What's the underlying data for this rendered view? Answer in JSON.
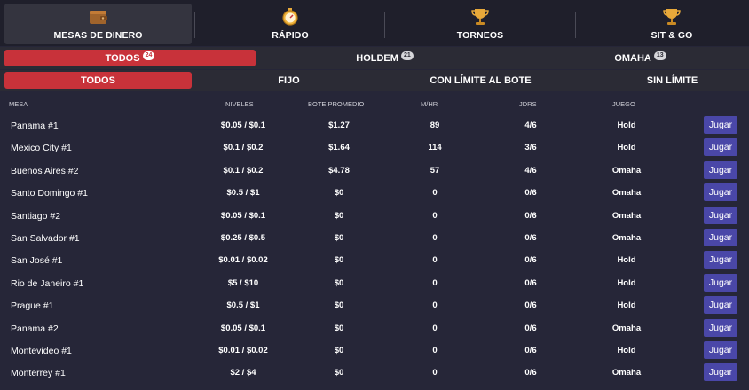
{
  "nav": {
    "tabs": [
      {
        "label": "MESAS DE DINERO",
        "icon": "wallet-icon"
      },
      {
        "label": "RÁPIDO",
        "icon": "stopwatch-icon"
      },
      {
        "label": "TORNEOS",
        "icon": "trophy-icon"
      },
      {
        "label": "SIT & GO",
        "icon": "trophy-icon"
      }
    ]
  },
  "game_filters": [
    {
      "label": "TODOS",
      "count": "24"
    },
    {
      "label": "HOLDEM",
      "count": "21"
    },
    {
      "label": "OMAHA",
      "count": "13"
    }
  ],
  "limit_filters": [
    "TODOS",
    "FIJO",
    "CON LÍMITE AL BOTE",
    "SIN LÍMITE"
  ],
  "table": {
    "headers": {
      "mesa": "MESA",
      "niveles": "NIVELES",
      "bote": "BOTE PROMEDIO",
      "mhr": "M/HR",
      "jdrs": "JDRS",
      "juego": "JUEGO"
    },
    "play_label": "Jugar",
    "rows": [
      [
        "Panama #1",
        "$0.05 / $0.1",
        "$1.27",
        "89",
        "4/6",
        "Hold"
      ],
      [
        "Mexico City #1",
        "$0.1 / $0.2",
        "$1.64",
        "114",
        "3/6",
        "Hold"
      ],
      [
        "Buenos Aires #2",
        "$0.1 / $0.2",
        "$4.78",
        "57",
        "4/6",
        "Omaha"
      ],
      [
        "Santo Domingo #1",
        "$0.5 / $1",
        "$0",
        "0",
        "0/6",
        "Omaha"
      ],
      [
        "Santiago #2",
        "$0.05 / $0.1",
        "$0",
        "0",
        "0/6",
        "Omaha"
      ],
      [
        "San Salvador #1",
        "$0.25 / $0.5",
        "$0",
        "0",
        "0/6",
        "Omaha"
      ],
      [
        "San José #1",
        "$0.01 / $0.02",
        "$0",
        "0",
        "0/6",
        "Hold"
      ],
      [
        "Rio de Janeiro #1",
        "$5 / $10",
        "$0",
        "0",
        "0/6",
        "Hold"
      ],
      [
        "Prague #1",
        "$0.5 / $1",
        "$0",
        "0",
        "0/6",
        "Hold"
      ],
      [
        "Panama #2",
        "$0.05 / $0.1",
        "$0",
        "0",
        "0/6",
        "Omaha"
      ],
      [
        "Montevideo #1",
        "$0.01 / $0.02",
        "$0",
        "0",
        "0/6",
        "Hold"
      ],
      [
        "Monterrey #1",
        "$2 / $4",
        "$0",
        "0",
        "0/6",
        "Omaha"
      ]
    ]
  },
  "colors": {
    "accent_red": "#c8323a",
    "play_button": "#4a47a8",
    "background": "#262638"
  }
}
